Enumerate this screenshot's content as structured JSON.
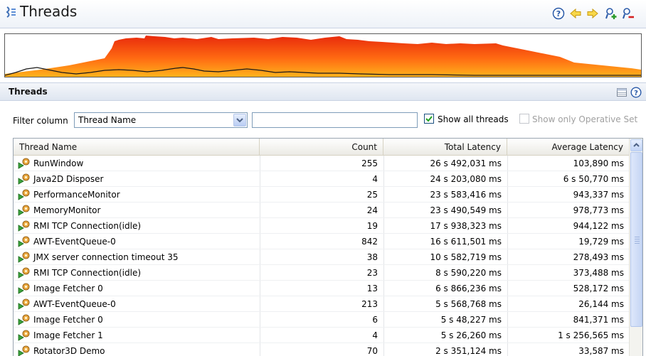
{
  "header": {
    "title": "Threads"
  },
  "section": {
    "title": "Threads"
  },
  "filter": {
    "label": "Filter column",
    "column_value": "Thread Name",
    "text_value": "",
    "show_all_label": "Show all threads",
    "show_all_checked": true,
    "operative_label": "Show only Operative Set",
    "operative_checked": false
  },
  "table": {
    "columns": [
      "Thread Name",
      "Count",
      "Total Latency",
      "Average Latency"
    ],
    "rows": [
      {
        "name": "RunWindow",
        "count": "255",
        "total": "26 s 492,031 ms",
        "avg": "103,890 ms"
      },
      {
        "name": "Java2D Disposer",
        "count": "4",
        "total": "24 s 203,080 ms",
        "avg": "6 s 50,770 ms"
      },
      {
        "name": "PerformanceMonitor",
        "count": "25",
        "total": "23 s 583,416 ms",
        "avg": "943,337 ms"
      },
      {
        "name": "MemoryMonitor",
        "count": "24",
        "total": "23 s 490,549 ms",
        "avg": "978,773 ms"
      },
      {
        "name": "RMI TCP Connection(idle)",
        "count": "19",
        "total": "17 s 938,323 ms",
        "avg": "944,122 ms"
      },
      {
        "name": "AWT-EventQueue-0",
        "count": "842",
        "total": "16 s 611,501 ms",
        "avg": "19,729 ms"
      },
      {
        "name": "JMX server connection timeout 35",
        "count": "38",
        "total": "10 s 582,719 ms",
        "avg": "278,493 ms"
      },
      {
        "name": "RMI TCP Connection(idle)",
        "count": "23",
        "total": "8 s 590,220 ms",
        "avg": "373,488 ms"
      },
      {
        "name": "Image Fetcher 0",
        "count": "13",
        "total": "6 s 866,236 ms",
        "avg": "528,172 ms"
      },
      {
        "name": "AWT-EventQueue-0",
        "count": "213",
        "total": "5 s 568,768 ms",
        "avg": "26,144 ms"
      },
      {
        "name": "Image Fetcher 0",
        "count": "6",
        "total": "5 s 48,227 ms",
        "avg": "841,371 ms"
      },
      {
        "name": "Image Fetcher 1",
        "count": "4",
        "total": "5 s 26,260 ms",
        "avg": "1 s 256,565 ms"
      },
      {
        "name": "Rotator3D Demo",
        "count": "70",
        "total": "2 s 351,124 ms",
        "avg": "33,587 ms"
      }
    ]
  },
  "colors": {
    "chart_fill_top": "#e82a0c",
    "chart_fill_bottom": "#ffb21c",
    "header_bg": "#eef2f8",
    "accent": "#1c5180"
  },
  "icons": [
    "threads-icon",
    "help-icon",
    "back-icon",
    "forward-icon",
    "add-user-icon",
    "remove-user-icon",
    "table-view-icon",
    "thread-icon",
    "dropdown-arrow-icon",
    "checkmark-icon"
  ]
}
